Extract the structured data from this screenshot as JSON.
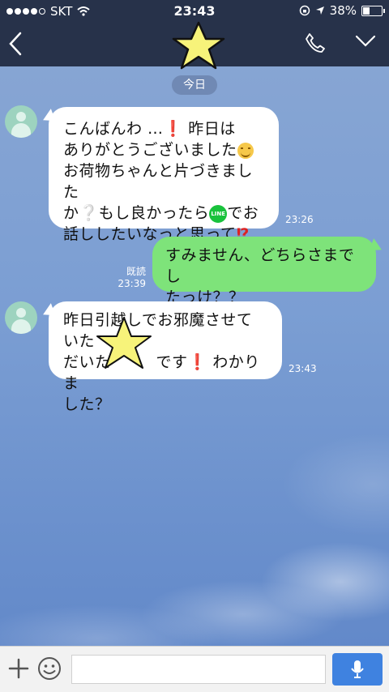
{
  "status": {
    "carrier": "SKT",
    "time": "23:43",
    "battery": "38%",
    "battery_level": 0.38,
    "signal_bars_filled": 4
  },
  "nav": {
    "back_icon": "chevron-left-icon",
    "phone_icon": "phone-icon",
    "menu_icon": "chevron-down-icon"
  },
  "date_separator": "今日",
  "messages": [
    {
      "direction": "in",
      "lines": [
        "こんばんわ …",
        "昨日は",
        "ありがとうございました",
        "お荷物ちゃんと片づきました",
        "か",
        "もし良かったら",
        "でお",
        "話ししたいなっと思って"
      ],
      "time": "23:26"
    },
    {
      "direction": "out",
      "text": "すみません、どちらさまでしたっけ？？",
      "line1": "すみません、どちらさまでし",
      "line2": "たっけ？？",
      "read": "既読",
      "time": "23:39"
    },
    {
      "direction": "in",
      "line1": "昨日引越しでお邪魔させていた",
      "line2a": "だいた",
      "line2b": "です",
      "line2c": "わかりま",
      "line3": "した？",
      "time": "23:43"
    }
  ],
  "inline": {
    "line_badge": "LINE",
    "red_exclaim": "❗",
    "grey_question": "❔",
    "red_exclaim_question": "⁉"
  },
  "colors": {
    "header": "#27324a",
    "outgoing_bubble": "#7ee37a",
    "incoming_bubble": "#ffffff",
    "mic_button": "#3f82e0",
    "star_sticker": "#f7f37a"
  },
  "input": {
    "placeholder": ""
  }
}
